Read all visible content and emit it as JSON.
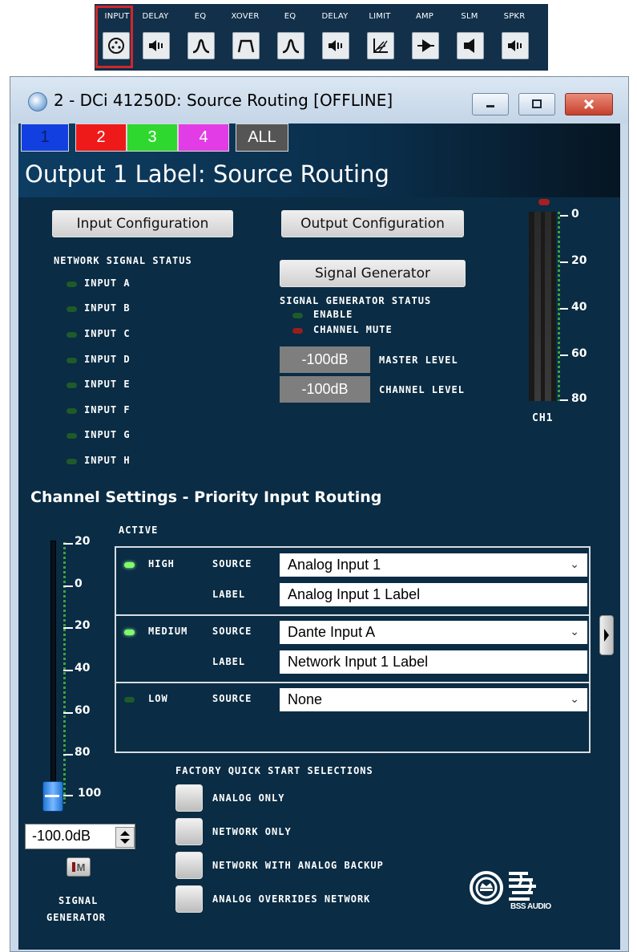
{
  "toolbar": {
    "items": [
      {
        "label": "INPUT",
        "icon": "xlr-input-icon"
      },
      {
        "label": "DELAY",
        "icon": "delay-icon"
      },
      {
        "label": "EQ",
        "icon": "eq-icon"
      },
      {
        "label": "XOVER",
        "icon": "xover-icon"
      },
      {
        "label": "EQ",
        "icon": "eq-icon"
      },
      {
        "label": "DELAY",
        "icon": "delay-icon"
      },
      {
        "label": "LIMIT",
        "icon": "limiter-icon"
      },
      {
        "label": "AMP",
        "icon": "amp-icon"
      },
      {
        "label": "SLM",
        "icon": "slm-icon"
      },
      {
        "label": "SPKR",
        "icon": "speaker-icon"
      }
    ],
    "selected": "INPUT",
    "selected_color": "#d0272c"
  },
  "window": {
    "title": "2 - DCi 41250D: Source Routing [OFFLINE]"
  },
  "channel_tabs": [
    {
      "label": "1",
      "color": "#1240e0"
    },
    {
      "label": "2",
      "color": "#ee1a1a"
    },
    {
      "label": "3",
      "color": "#2fd82f"
    },
    {
      "label": "4",
      "color": "#e23ce6"
    },
    {
      "label": "ALL",
      "color": "#555555"
    }
  ],
  "page_title": "Output 1 Label: Source Routing",
  "buttons": {
    "input_config": "Input Configuration",
    "output_config": "Output Configuration",
    "signal_generator": "Signal Generator"
  },
  "network_status": {
    "title": "NETWORK SIGNAL STATUS",
    "inputs": [
      "INPUT A",
      "INPUT B",
      "INPUT C",
      "INPUT D",
      "INPUT E",
      "INPUT F",
      "INPUT G",
      "INPUT H"
    ]
  },
  "siggen_status": {
    "title": "SIGNAL GENERATOR STATUS",
    "enable": "ENABLE",
    "channel_mute": "CHANNEL MUTE",
    "master_value": "-100dB",
    "master_label": "MASTER LEVEL",
    "channel_value": "-100dB",
    "channel_label": "CHANNEL LEVEL"
  },
  "meter": {
    "label": "CH1",
    "scale": [
      "0",
      "20",
      "40",
      "60",
      "80"
    ]
  },
  "section_title": "Channel Settings - Priority Input Routing",
  "routing": {
    "active_label": "ACTIVE",
    "source_label": "SOURCE",
    "label_label": "LABEL",
    "rows": [
      {
        "priority": "HIGH",
        "source": "Analog Input 1",
        "label": "Analog Input 1 Label",
        "active": true
      },
      {
        "priority": "MEDIUM",
        "source": "Dante Input A",
        "label": "Network Input 1 Label",
        "active": true
      },
      {
        "priority": "LOW",
        "source": "None",
        "active": false
      }
    ]
  },
  "fader": {
    "scale": [
      "20",
      "0",
      "20",
      "40",
      "60",
      "80",
      "100"
    ],
    "value": "-100.0dB",
    "mute_label": "M",
    "caption_line1": "SIGNAL",
    "caption_line2": "GENERATOR"
  },
  "quick_start": {
    "title": "FACTORY QUICK START SELECTIONS",
    "options": [
      "ANALOG ONLY",
      "NETWORK ONLY",
      "NETWORK WITH ANALOG BACKUP",
      "ANALOG OVERRIDES NETWORK"
    ]
  },
  "logo": {
    "text": "BSS AUDIO"
  }
}
